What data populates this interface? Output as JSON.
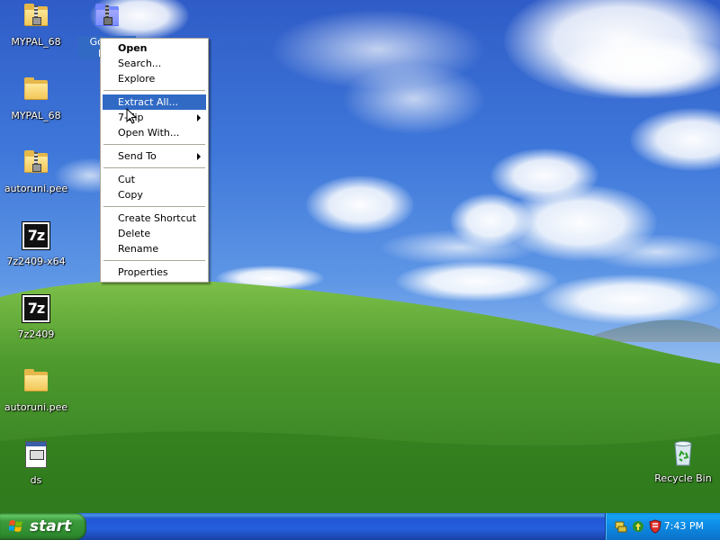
{
  "desktop": {
    "icons": [
      {
        "label": "MYPAL_68",
        "type": "zip-folder"
      },
      {
        "label": "Google Rec",
        "type": "zip-folder",
        "selected": true
      },
      {
        "label": "MYPAL_68",
        "type": "folder"
      },
      {
        "label": "autoruni.pee",
        "type": "zip-folder"
      },
      {
        "label": "7z2409-x64",
        "type": "7zip-installer"
      },
      {
        "label": "7z2409",
        "type": "7zip-installer"
      },
      {
        "label": "autoruni.pee",
        "type": "folder"
      },
      {
        "label": "ds",
        "type": "document"
      },
      {
        "label": "Recycle Bin",
        "type": "recycle-bin"
      }
    ]
  },
  "context_menu": {
    "items": [
      {
        "label": "Open",
        "bold": true
      },
      {
        "label": "Search..."
      },
      {
        "label": "Explore"
      },
      {
        "label": "Extract All...",
        "highlighted": true
      },
      {
        "label": "7-Zip",
        "submenu": true
      },
      {
        "label": "Open With..."
      },
      {
        "label": "Send To",
        "submenu": true
      },
      {
        "label": "Cut"
      },
      {
        "label": "Copy"
      },
      {
        "label": "Create Shortcut"
      },
      {
        "label": "Delete"
      },
      {
        "label": "Rename"
      },
      {
        "label": "Properties"
      }
    ]
  },
  "taskbar": {
    "start_label": "start",
    "clock": "7:43 PM",
    "tray_icons": [
      "network-icon",
      "update-icon",
      "security-shield-icon"
    ]
  },
  "colors": {
    "selection": "#316ac5",
    "taskbar_blue": "#245edb",
    "start_green": "#3c9b3c"
  }
}
